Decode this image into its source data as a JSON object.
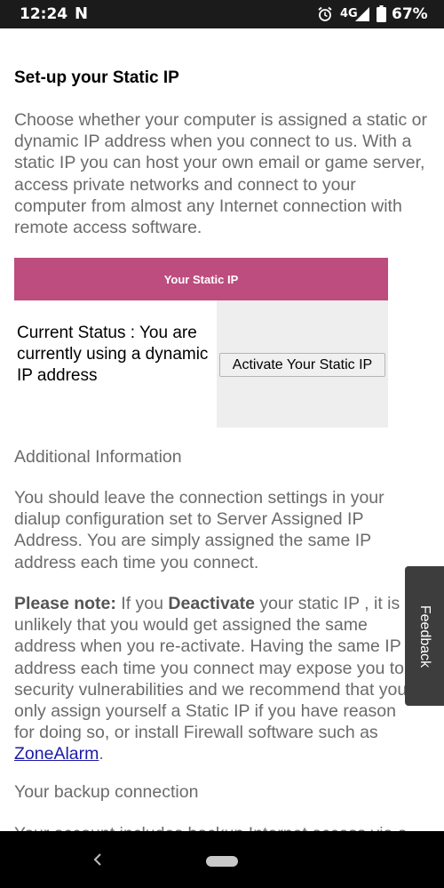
{
  "status_bar": {
    "time": "12:24",
    "app_icon": "N",
    "network": "4G",
    "battery": "67%"
  },
  "page": {
    "title": "Set-up your Static IP",
    "intro": "Choose whether your computer is assigned a static or dynamic IP address when you connect to us. With a static IP you can host your own email or game server, access private networks and connect to your computer from almost any Internet connection with remote access software.",
    "panel": {
      "header": "Your Static IP",
      "status": "Current Status :  You are currently using a dynamic IP address",
      "button": "Activate Your Static IP"
    },
    "additional_heading": "Additional Information",
    "para1_lines": [
      "You should leave the connection settings in your",
      "dialup configuration set to Server Assigned IP",
      "Address. You are simply assigned the same IP",
      "address each time you connect."
    ],
    "para2": {
      "note_label": "Please note:",
      "seg1": " If you ",
      "deactivate": "Deactivate",
      "seg2": " your static IP , it is",
      "lines": [
        "unlikely that you would get assigned the same",
        "address when you re-activate. Having the same IP",
        "address each time you connect may expose you to",
        "security vulnerabilities and we recommend that you",
        "only assign yourself a Static IP if you have reason",
        "for doing so, or install Firewall software such as"
      ],
      "link": "ZoneAlarm",
      "end": "."
    },
    "backup_heading": "Your backup connection",
    "backup_text": "Your account includes backup Internet access via a"
  },
  "feedback": "Feedback"
}
